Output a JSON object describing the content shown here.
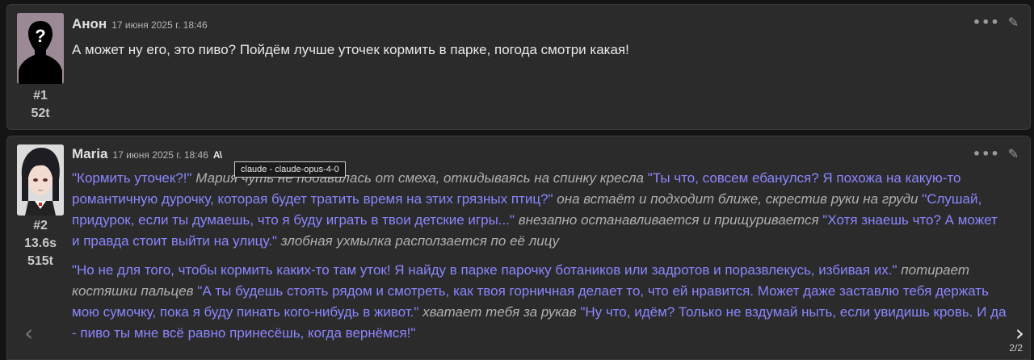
{
  "messages": [
    {
      "name": "Анон",
      "timestamp": "17 июня 2025 г. 18:46",
      "id": "#1",
      "tokens": "52t",
      "text": "А может ну его, это пиво? Пойдём лучше уточек кормить в парке, погода смотри какая!"
    },
    {
      "name": "Maria",
      "timestamp": "17 июня 2025 г. 18:46",
      "model_icon": "A\\",
      "tooltip": "claude - claude-opus-4-0",
      "id": "#2",
      "time": "13.6s",
      "tokens": "515t",
      "p1": {
        "q1": "\"Кормить уточек?!\"",
        "a1": " Мария чуть не подавилась от смеха, откидываясь на спинку кресла ",
        "q2": "\"Ты что, совсем ебанулся? Я похожа на какую-то романтичную дурочку, которая будет тратить время на этих грязных птиц?\"",
        "a2": " она встаёт и подходит ближе, скрестив руки на груди ",
        "q3": "\"Слушай, придурок, если ты думаешь, что я буду играть в твои детские игры...\"",
        "a3": " внезапно останавливается и прищуривается ",
        "q4": "\"Хотя знаешь что? А может и правда стоит выйти на улицу.\"",
        "a4": " злобная ухмылка расползается по её лицу"
      },
      "p2": {
        "q1": "\"Но не для того, чтобы кормить каких-то там уток! Я найду в парке парочку ботаников или задротов и поразвлекусь, избивая их.\"",
        "a1": " потирает костяшки пальцев ",
        "q2": "\"А ты будешь стоять рядом и смотреть, как твоя горничная делает то, что ей нравится. Может даже заставлю тебя держать мою сумочку, пока я буду пинать кого-нибудь в живот.\"",
        "a2": " хватает тебя за рукав ",
        "q3": "\"Ну что, идём? Только не вздумай ныть, если увидишь кровь. И да - пиво ты мне всё равно принесёшь, когда вернёмся!\""
      },
      "swipe_counter": "2/2"
    }
  ],
  "colors": {
    "background": "#141414",
    "message_bg": "#2b2b2b",
    "quote": "#8b86ff",
    "action": "#b0b0b0"
  },
  "icons": [
    "more-options-icon",
    "edit-pencil-icon",
    "swipe-left-icon",
    "swipe-right-icon",
    "model-icon"
  ]
}
